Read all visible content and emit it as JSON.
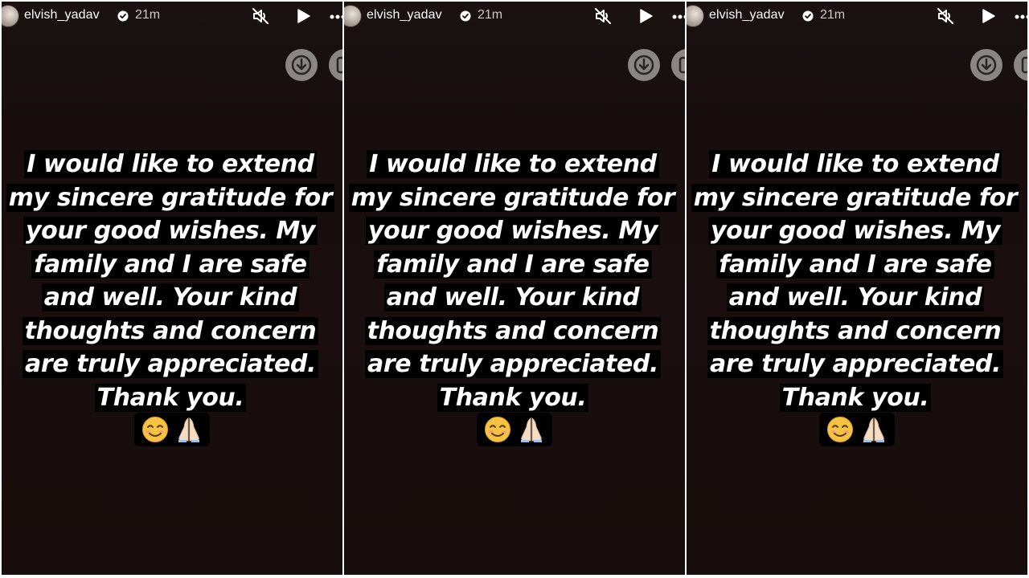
{
  "story": {
    "username": "elvish_yadav",
    "timestamp": "21m",
    "lines": [
      "I would like to extend",
      "my sincere gratitude for",
      "your good wishes. My",
      "family and I are safe",
      "and well. Your kind",
      "thoughts and concern",
      "are truly appreciated.",
      "Thank you."
    ],
    "emojis": [
      "smiling-face-emoji",
      "folded-hands-emoji"
    ]
  },
  "icons": {
    "verified": "verified-badge-icon",
    "mute": "muted-speaker-icon",
    "play": "play-icon",
    "more": "more-options-icon",
    "download": "download-icon",
    "second_action": "action-icon"
  },
  "colors": {
    "background": "#170e0d",
    "text": "#ffffff",
    "text_highlight": "#000000",
    "timestamp": "#cfc9c6",
    "button_gray": "#8a8685"
  }
}
